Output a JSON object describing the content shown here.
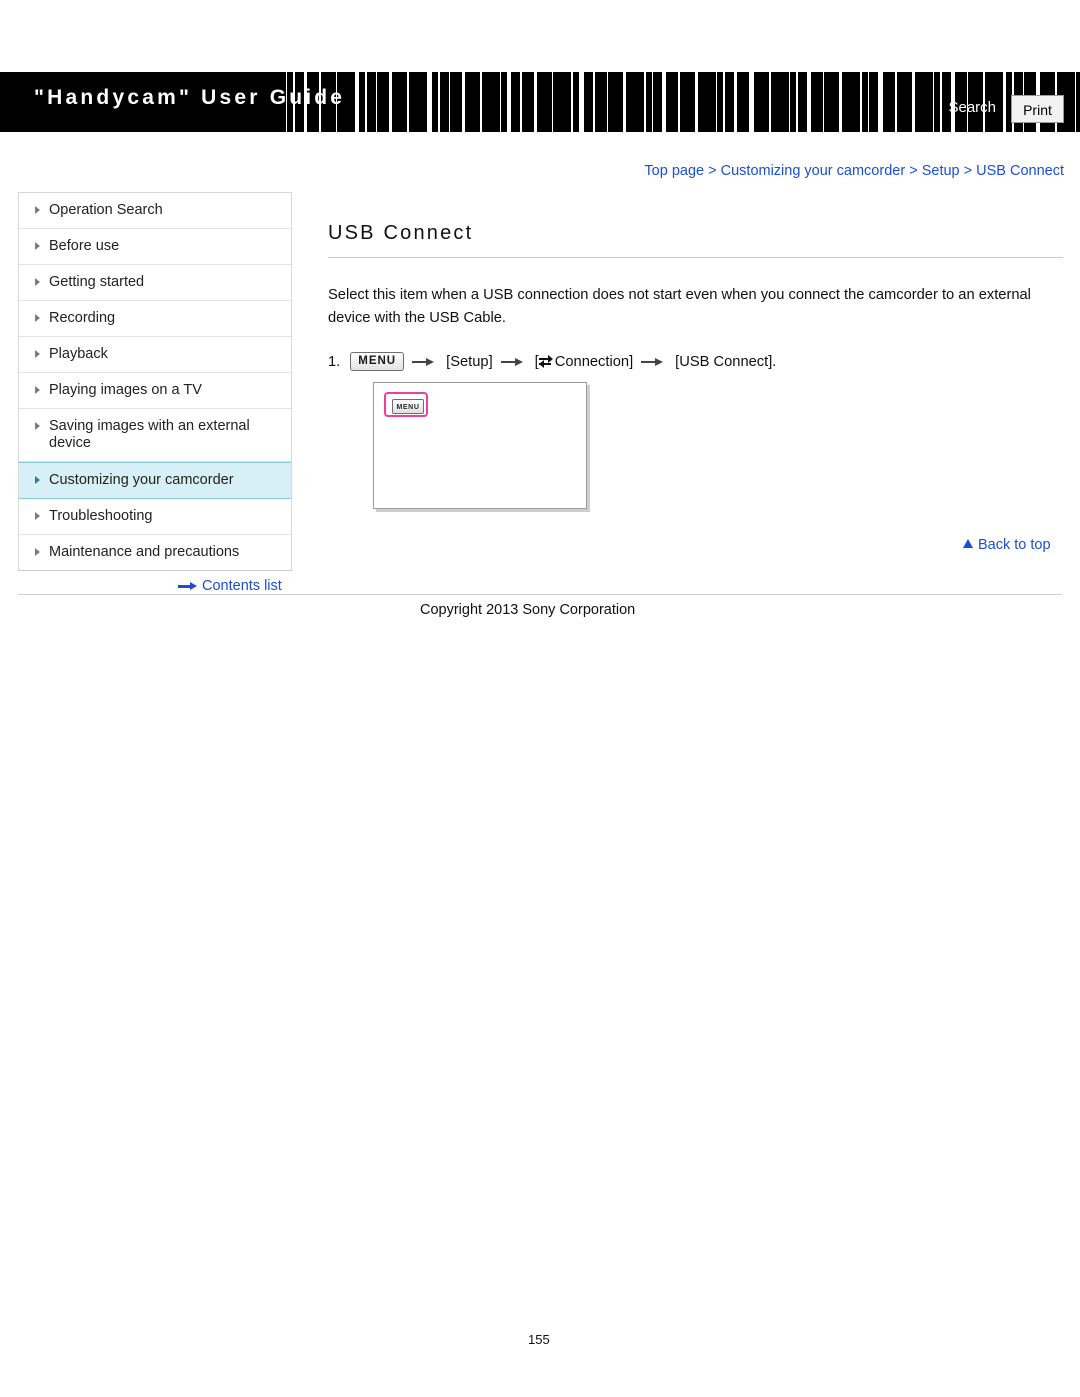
{
  "header": {
    "title": "\"Handycam\" User Guide",
    "search_label": "Search",
    "print_label": "Print"
  },
  "breadcrumb": {
    "items": [
      "Top page",
      "Customizing your camcorder",
      "Setup",
      "USB Connect"
    ],
    "separator": ">"
  },
  "sidebar": {
    "items": [
      {
        "label": "Operation Search",
        "active": false
      },
      {
        "label": "Before use",
        "active": false
      },
      {
        "label": "Getting started",
        "active": false
      },
      {
        "label": "Recording",
        "active": false
      },
      {
        "label": "Playback",
        "active": false
      },
      {
        "label": "Playing images on a TV",
        "active": false
      },
      {
        "label": "Saving images with an external device",
        "active": false
      },
      {
        "label": "Customizing your camcorder",
        "active": true
      },
      {
        "label": "Troubleshooting",
        "active": false
      },
      {
        "label": "Maintenance and precautions",
        "active": false
      }
    ],
    "contents_list_label": "Contents list"
  },
  "main": {
    "page_title": "USB Connect",
    "intro": "Select this item when a USB connection does not start even when you connect the camcorder to an external device with the USB Cable.",
    "step": {
      "number": "1.",
      "menu_chip": "MENU",
      "setup_label": "[Setup]",
      "connection_label": "Connection]",
      "connection_bracket_open": "[",
      "usb_connect_label": "[USB Connect].",
      "screen_menu_label": "MENU"
    },
    "back_to_top": "Back to top"
  },
  "footer": {
    "copyright": "Copyright 2013 Sony Corporation",
    "page_number": "155"
  },
  "colors": {
    "link": "#1a4fd6",
    "highlight": "#d7f0f7",
    "accent_pink": "#ec3fa0"
  }
}
